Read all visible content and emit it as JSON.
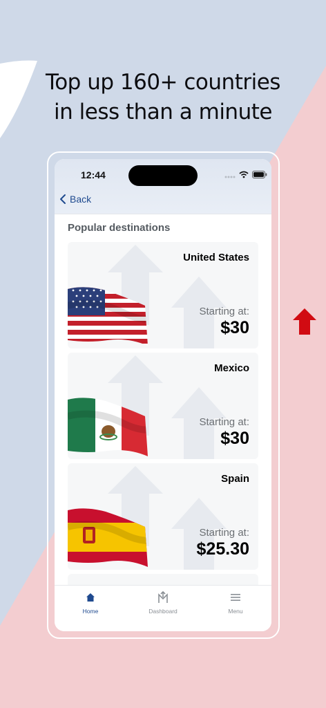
{
  "headline": {
    "line1": "Top up 160+ countries",
    "line2": "in less than a minute"
  },
  "colors": {
    "bg_blue": "#cfd9e8",
    "bg_pink": "#f3cdd0",
    "accent_red": "#d10b12",
    "nav_blue": "#1f4a8f"
  },
  "status_bar": {
    "time": "12:44",
    "icons": [
      "signal-icon",
      "wifi-icon",
      "battery-icon"
    ]
  },
  "nav": {
    "back_label": "Back"
  },
  "section": {
    "title": "Popular destinations"
  },
  "destinations": [
    {
      "country": "United States",
      "starting_label": "Starting at:",
      "price": "$30",
      "flag": "us-flag"
    },
    {
      "country": "Mexico",
      "starting_label": "Starting at:",
      "price": "$30",
      "flag": "mexico-flag"
    },
    {
      "country": "Spain",
      "starting_label": "Starting at:",
      "price": "$25.30",
      "flag": "spain-flag"
    }
  ],
  "tabbar": {
    "items": [
      {
        "label": "Home",
        "icon": "home-icon",
        "active": true
      },
      {
        "label": "Dashboard",
        "icon": "dashboard-logo-icon",
        "active": false
      },
      {
        "label": "Menu",
        "icon": "menu-icon",
        "active": false
      }
    ]
  }
}
